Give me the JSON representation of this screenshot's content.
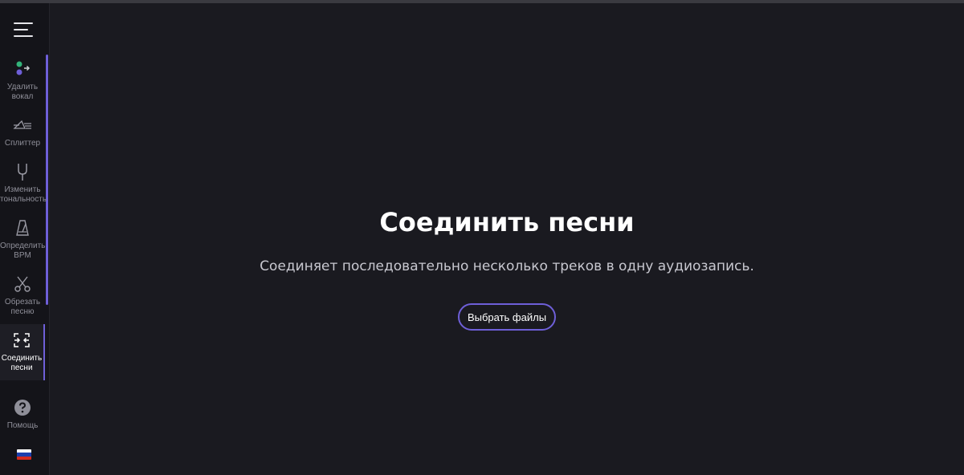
{
  "sidebar": {
    "items": [
      {
        "label": "Удалить\nвокал",
        "icon": "vocal-remover-icon"
      },
      {
        "label": "Сплиттер",
        "icon": "splitter-icon"
      },
      {
        "label": "Изменить\nтональность",
        "icon": "tuning-fork-icon"
      },
      {
        "label": "Определить\nBPM",
        "icon": "metronome-icon"
      },
      {
        "label": "Обрезать\nпесню",
        "icon": "scissors-icon"
      },
      {
        "label": "Соединить\nпесни",
        "icon": "joiner-icon",
        "active": true
      }
    ],
    "help": {
      "label": "Помощь",
      "icon": "help-icon"
    },
    "language": {
      "icon": "russia-flag-icon"
    }
  },
  "main": {
    "title": "Соединить песни",
    "subtitle": "Соединяет последовательно несколько треков в одну аудиозапись.",
    "button_label": "Выбрать файлы"
  },
  "colors": {
    "background": "#1a1a20",
    "sidebar": "#141419",
    "accent": "#6e5fd8",
    "dot_green": "#33b37a",
    "dot_purple": "#6e5fd8"
  }
}
